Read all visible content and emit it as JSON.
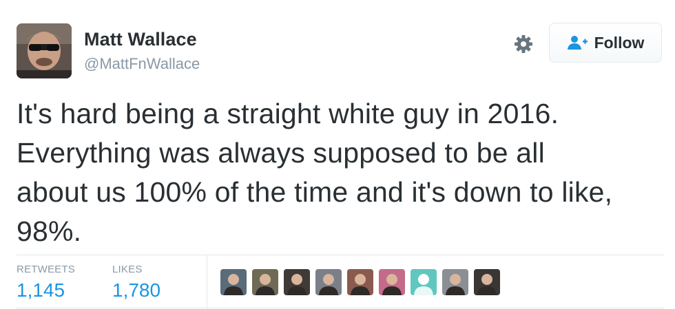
{
  "user": {
    "name": "Matt Wallace",
    "handle": "@MattFnWallace"
  },
  "actions": {
    "follow_label": "Follow"
  },
  "tweet": {
    "text": "It's hard being a straight white guy in 2016.\nEverything was always supposed to be all\nabout us 100% of the time and it's down to like,\n98%."
  },
  "stats": {
    "retweets_label": "RETWEETS",
    "retweets_count": "1,145",
    "likes_label": "LIKES",
    "likes_count": "1,780"
  },
  "likers": [
    {
      "icon": "liker-avatar-1",
      "color": "#5a6b7a"
    },
    {
      "icon": "liker-avatar-2",
      "color": "#6f6a55"
    },
    {
      "icon": "liker-avatar-3",
      "color": "#3f3a36"
    },
    {
      "icon": "liker-avatar-4",
      "color": "#7a7f88"
    },
    {
      "icon": "liker-avatar-5",
      "color": "#8a5a4e"
    },
    {
      "icon": "liker-avatar-6",
      "color": "#c46a8a"
    },
    {
      "icon": "liker-avatar-7",
      "color": "#5fc7c0"
    },
    {
      "icon": "liker-avatar-8",
      "color": "#8a8f96"
    },
    {
      "icon": "liker-avatar-9",
      "color": "#3a3634"
    }
  ],
  "colors": {
    "link_blue": "#1b95e0",
    "muted_gray": "#8899a6",
    "border": "#e1e8ed",
    "text": "#292f33"
  }
}
